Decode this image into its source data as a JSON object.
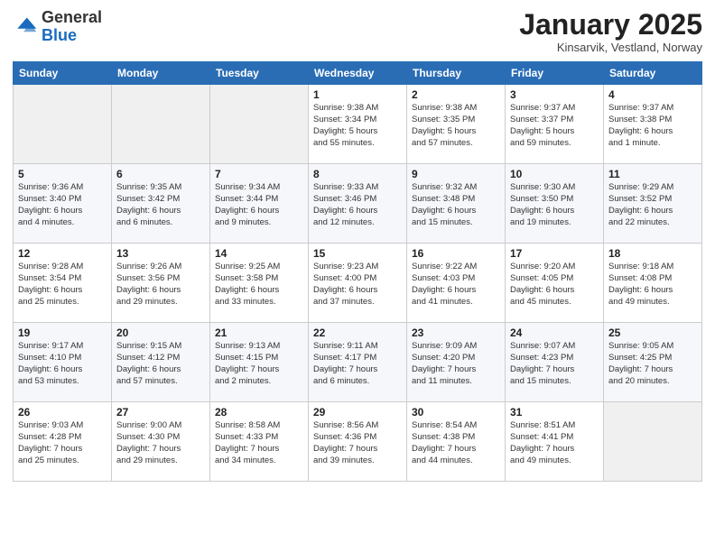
{
  "header": {
    "logo_general": "General",
    "logo_blue": "Blue",
    "month_title": "January 2025",
    "subtitle": "Kinsarvik, Vestland, Norway"
  },
  "days_of_week": [
    "Sunday",
    "Monday",
    "Tuesday",
    "Wednesday",
    "Thursday",
    "Friday",
    "Saturday"
  ],
  "weeks": [
    [
      {
        "day": "",
        "info": ""
      },
      {
        "day": "",
        "info": ""
      },
      {
        "day": "",
        "info": ""
      },
      {
        "day": "1",
        "info": "Sunrise: 9:38 AM\nSunset: 3:34 PM\nDaylight: 5 hours\nand 55 minutes."
      },
      {
        "day": "2",
        "info": "Sunrise: 9:38 AM\nSunset: 3:35 PM\nDaylight: 5 hours\nand 57 minutes."
      },
      {
        "day": "3",
        "info": "Sunrise: 9:37 AM\nSunset: 3:37 PM\nDaylight: 5 hours\nand 59 minutes."
      },
      {
        "day": "4",
        "info": "Sunrise: 9:37 AM\nSunset: 3:38 PM\nDaylight: 6 hours\nand 1 minute."
      }
    ],
    [
      {
        "day": "5",
        "info": "Sunrise: 9:36 AM\nSunset: 3:40 PM\nDaylight: 6 hours\nand 4 minutes."
      },
      {
        "day": "6",
        "info": "Sunrise: 9:35 AM\nSunset: 3:42 PM\nDaylight: 6 hours\nand 6 minutes."
      },
      {
        "day": "7",
        "info": "Sunrise: 9:34 AM\nSunset: 3:44 PM\nDaylight: 6 hours\nand 9 minutes."
      },
      {
        "day": "8",
        "info": "Sunrise: 9:33 AM\nSunset: 3:46 PM\nDaylight: 6 hours\nand 12 minutes."
      },
      {
        "day": "9",
        "info": "Sunrise: 9:32 AM\nSunset: 3:48 PM\nDaylight: 6 hours\nand 15 minutes."
      },
      {
        "day": "10",
        "info": "Sunrise: 9:30 AM\nSunset: 3:50 PM\nDaylight: 6 hours\nand 19 minutes."
      },
      {
        "day": "11",
        "info": "Sunrise: 9:29 AM\nSunset: 3:52 PM\nDaylight: 6 hours\nand 22 minutes."
      }
    ],
    [
      {
        "day": "12",
        "info": "Sunrise: 9:28 AM\nSunset: 3:54 PM\nDaylight: 6 hours\nand 25 minutes."
      },
      {
        "day": "13",
        "info": "Sunrise: 9:26 AM\nSunset: 3:56 PM\nDaylight: 6 hours\nand 29 minutes."
      },
      {
        "day": "14",
        "info": "Sunrise: 9:25 AM\nSunset: 3:58 PM\nDaylight: 6 hours\nand 33 minutes."
      },
      {
        "day": "15",
        "info": "Sunrise: 9:23 AM\nSunset: 4:00 PM\nDaylight: 6 hours\nand 37 minutes."
      },
      {
        "day": "16",
        "info": "Sunrise: 9:22 AM\nSunset: 4:03 PM\nDaylight: 6 hours\nand 41 minutes."
      },
      {
        "day": "17",
        "info": "Sunrise: 9:20 AM\nSunset: 4:05 PM\nDaylight: 6 hours\nand 45 minutes."
      },
      {
        "day": "18",
        "info": "Sunrise: 9:18 AM\nSunset: 4:08 PM\nDaylight: 6 hours\nand 49 minutes."
      }
    ],
    [
      {
        "day": "19",
        "info": "Sunrise: 9:17 AM\nSunset: 4:10 PM\nDaylight: 6 hours\nand 53 minutes."
      },
      {
        "day": "20",
        "info": "Sunrise: 9:15 AM\nSunset: 4:12 PM\nDaylight: 6 hours\nand 57 minutes."
      },
      {
        "day": "21",
        "info": "Sunrise: 9:13 AM\nSunset: 4:15 PM\nDaylight: 7 hours\nand 2 minutes."
      },
      {
        "day": "22",
        "info": "Sunrise: 9:11 AM\nSunset: 4:17 PM\nDaylight: 7 hours\nand 6 minutes."
      },
      {
        "day": "23",
        "info": "Sunrise: 9:09 AM\nSunset: 4:20 PM\nDaylight: 7 hours\nand 11 minutes."
      },
      {
        "day": "24",
        "info": "Sunrise: 9:07 AM\nSunset: 4:23 PM\nDaylight: 7 hours\nand 15 minutes."
      },
      {
        "day": "25",
        "info": "Sunrise: 9:05 AM\nSunset: 4:25 PM\nDaylight: 7 hours\nand 20 minutes."
      }
    ],
    [
      {
        "day": "26",
        "info": "Sunrise: 9:03 AM\nSunset: 4:28 PM\nDaylight: 7 hours\nand 25 minutes."
      },
      {
        "day": "27",
        "info": "Sunrise: 9:00 AM\nSunset: 4:30 PM\nDaylight: 7 hours\nand 29 minutes."
      },
      {
        "day": "28",
        "info": "Sunrise: 8:58 AM\nSunset: 4:33 PM\nDaylight: 7 hours\nand 34 minutes."
      },
      {
        "day": "29",
        "info": "Sunrise: 8:56 AM\nSunset: 4:36 PM\nDaylight: 7 hours\nand 39 minutes."
      },
      {
        "day": "30",
        "info": "Sunrise: 8:54 AM\nSunset: 4:38 PM\nDaylight: 7 hours\nand 44 minutes."
      },
      {
        "day": "31",
        "info": "Sunrise: 8:51 AM\nSunset: 4:41 PM\nDaylight: 7 hours\nand 49 minutes."
      },
      {
        "day": "",
        "info": ""
      }
    ]
  ]
}
